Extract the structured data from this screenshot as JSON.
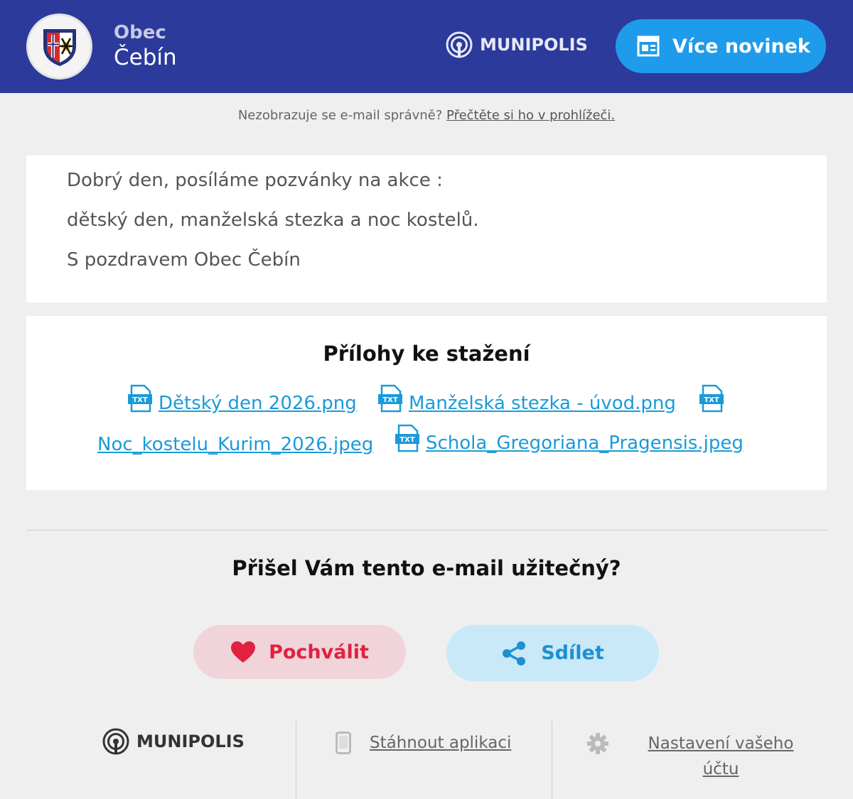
{
  "header": {
    "town_prefix": "Obec",
    "town_name": "Čebín",
    "brand": "MUNIPOLIS",
    "more_news_label": "Více novinek"
  },
  "notice": {
    "text": "Nezobrazuje se e-mail správně?",
    "link": "Přečtěte si ho v prohlížeči."
  },
  "message": {
    "lines": [
      "Dobrý den, posíláme pozvánky na akce :",
      "dětský den, manželská stezka a noc kostelů.",
      "S pozdravem Obec Čebín"
    ]
  },
  "attachments": {
    "title": "Přílohy ke stažení",
    "icon_label": "TXT",
    "files": [
      "Dětský den 2026.png",
      "Manželská stezka - úvod.png",
      "Noc_kostelu_Kurim_2026.jpeg",
      "Schola_Gregoriana_Pragensis.jpeg"
    ]
  },
  "feedback": {
    "question": "Přišel Vám tento e-mail užitečný?",
    "praise_label": "Pochválit",
    "share_label": "Sdílet"
  },
  "footer": {
    "brand": "MUNIPOLIS",
    "download_app": "Stáhnout aplikaci",
    "settings_line1": "Nastavení vašeho",
    "settings_line2": "účtu"
  },
  "colors": {
    "header_bg": "#2b3a9b",
    "accent_blue": "#1e9bea",
    "link_blue": "#1b9ad8",
    "praise_red": "#e0213f"
  },
  "icons": {
    "coat_of_arms": "coat-of-arms-icon",
    "broadcast": "broadcast-icon",
    "newspaper": "newspaper-icon",
    "file": "txt-file-icon",
    "heart": "heart-icon",
    "share": "share-icon",
    "phone": "phone-icon",
    "gear": "gear-icon"
  }
}
